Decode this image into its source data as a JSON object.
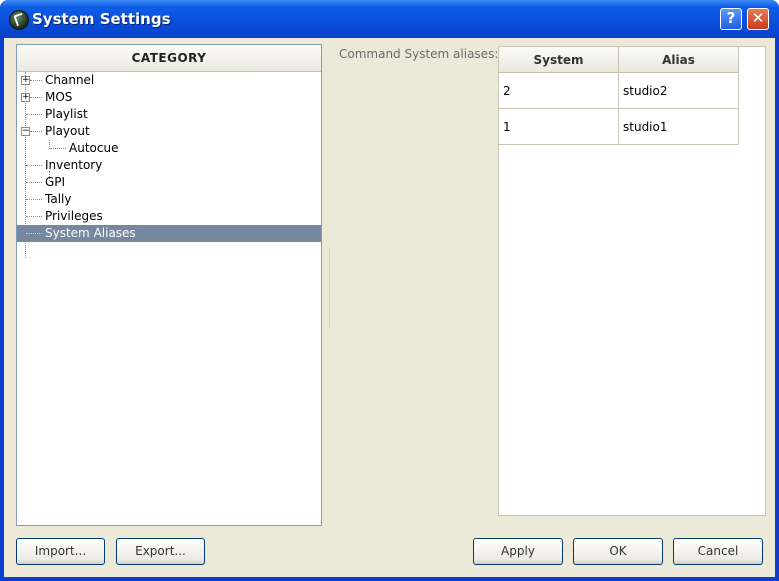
{
  "window": {
    "title": "System Settings",
    "help_glyph": "?",
    "close_glyph": "✕"
  },
  "category": {
    "header": "CATEGORY",
    "items": [
      {
        "label": "Channel",
        "expander": "+"
      },
      {
        "label": "MOS",
        "expander": "+"
      },
      {
        "label": "Playlist"
      },
      {
        "label": "Playout",
        "expander": "−"
      },
      {
        "label": "Autocue"
      },
      {
        "label": "Inventory"
      },
      {
        "label": "GPI"
      },
      {
        "label": "Tally"
      },
      {
        "label": "Privileges"
      },
      {
        "label": "System Aliases",
        "selected": true
      }
    ]
  },
  "aliases": {
    "label": "Command System aliases:",
    "columns": [
      "System",
      "Alias"
    ],
    "rows": [
      {
        "system": "2",
        "alias": "studio2"
      },
      {
        "system": "1",
        "alias": "studio1"
      }
    ]
  },
  "buttons": {
    "import": "Import...",
    "export": "Export...",
    "apply": "Apply",
    "ok": "OK",
    "cancel": "Cancel"
  },
  "colors": {
    "titlebar": "#0a4fdb",
    "selection": "#7687a0",
    "dialog": "#ece9d8"
  }
}
